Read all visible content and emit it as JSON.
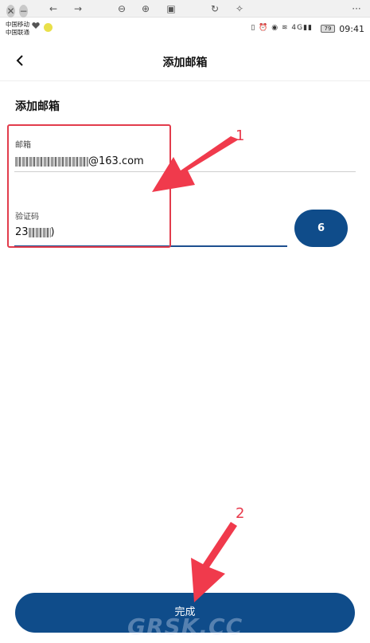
{
  "viewer": {
    "icons": [
      "close-icon",
      "minimize-icon",
      "back-arrow-icon",
      "forward-arrow-icon",
      "zoom-out-icon",
      "zoom-in-icon",
      "fit-icon",
      "rotate-icon",
      "magic-wand-icon",
      "more-icon"
    ],
    "more_label": "···"
  },
  "status_bar": {
    "carrier_1": "中国移动",
    "carrier_2": "中国联通",
    "battery": "79",
    "time": "09:41",
    "network": "4G"
  },
  "nav": {
    "title": "添加邮箱"
  },
  "form": {
    "section_title": "添加邮箱",
    "email_label": "邮箱",
    "email_suffix": "@163.com",
    "code_label": "验证码",
    "code_prefix": "23",
    "code_suffix": ")",
    "send_code_label": "6"
  },
  "done_label": "完成",
  "annotations": {
    "marker_1": "1",
    "marker_2": "2"
  },
  "colors": {
    "accent": "#0f4c8a",
    "annotation": "#e23c4c"
  }
}
